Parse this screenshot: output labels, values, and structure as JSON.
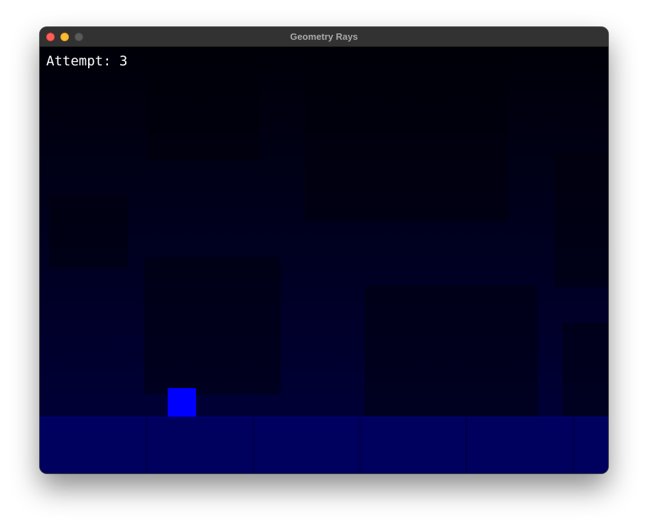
{
  "window": {
    "title": "Geometry Rays",
    "controls": {
      "close_color": "#ff5f57",
      "minimize_color": "#febc2e",
      "zoom_color": "#5a5a5a"
    }
  },
  "hud": {
    "attempt_label": "Attempt:",
    "attempt_value": "3"
  },
  "game": {
    "player_color": "#0000ff",
    "ground_color": "#00005f",
    "sky_top_color": "#000008",
    "sky_bottom_color": "#000036"
  }
}
